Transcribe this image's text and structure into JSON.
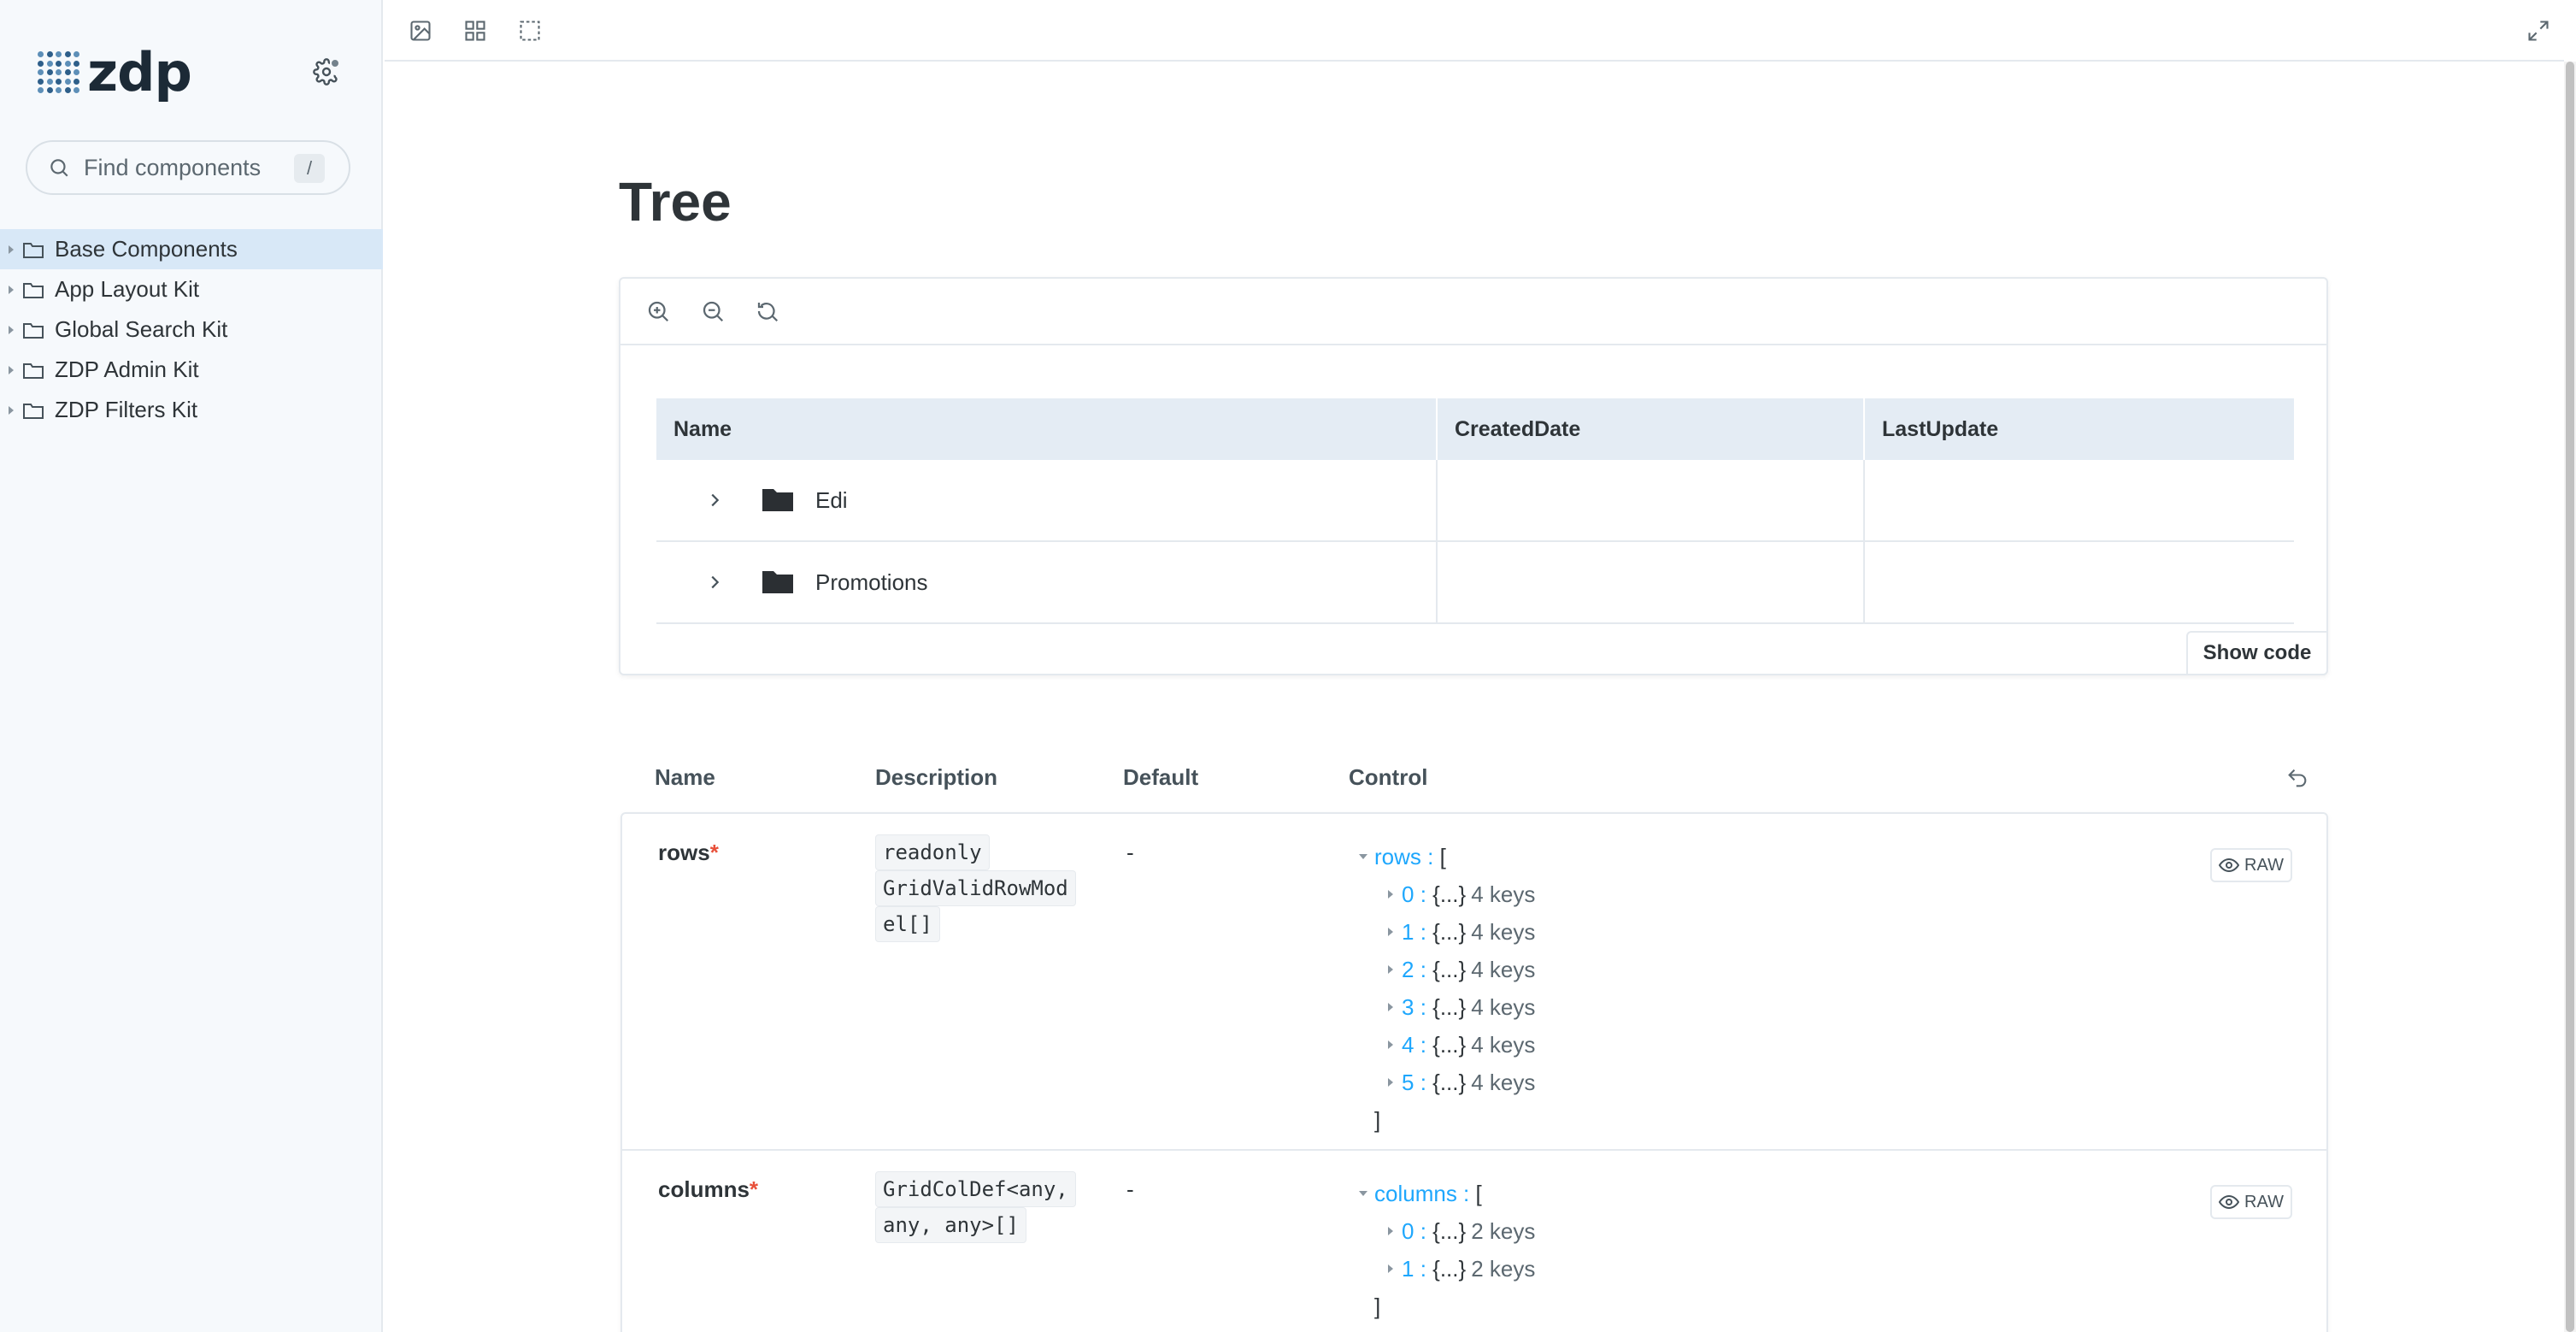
{
  "sidebar": {
    "brand": "zdp",
    "search_placeholder": "Find components",
    "search_shortcut": "/",
    "items": [
      {
        "label": "Base Components"
      },
      {
        "label": "App Layout Kit"
      },
      {
        "label": "Global Search Kit"
      },
      {
        "label": "ZDP Admin Kit"
      },
      {
        "label": "ZDP Filters Kit"
      }
    ]
  },
  "main": {
    "title": "Tree",
    "grid": {
      "headers": [
        "Name",
        "CreatedDate",
        "LastUpdate"
      ],
      "rows": [
        {
          "name": "Edi",
          "created": "",
          "updated": ""
        },
        {
          "name": "Promotions",
          "created": "",
          "updated": ""
        }
      ]
    },
    "show_code_label": "Show code"
  },
  "args": {
    "headers": [
      "Name",
      "Description",
      "Default",
      "Control"
    ],
    "rows": [
      {
        "name": "rows",
        "required_mark": "*",
        "type_lines": [
          "readonly",
          "GridValidRowMod",
          "el[]"
        ],
        "default": "-",
        "control_key": "rows",
        "open_bracket": "[",
        "close_bracket": "]",
        "entries": [
          {
            "index": "0",
            "summary": "{...}",
            "count": "4 keys"
          },
          {
            "index": "1",
            "summary": "{...}",
            "count": "4 keys"
          },
          {
            "index": "2",
            "summary": "{...}",
            "count": "4 keys"
          },
          {
            "index": "3",
            "summary": "{...}",
            "count": "4 keys"
          },
          {
            "index": "4",
            "summary": "{...}",
            "count": "4 keys"
          },
          {
            "index": "5",
            "summary": "{...}",
            "count": "4 keys"
          }
        ],
        "raw_label": "RAW"
      },
      {
        "name": "columns",
        "required_mark": "*",
        "type_lines": [
          "GridColDef<any,",
          "any, any>[]"
        ],
        "default": "-",
        "control_key": "columns",
        "open_bracket": "[",
        "close_bracket": "]",
        "entries": [
          {
            "index": "0",
            "summary": "{...}",
            "count": "2 keys"
          },
          {
            "index": "1",
            "summary": "{...}",
            "count": "2 keys"
          }
        ],
        "raw_label": "RAW"
      }
    ]
  },
  "icons": {
    "toolbar": [
      "image-icon",
      "grid-icon",
      "outline-icon",
      "fullscreen-icon"
    ],
    "preview_toolbar": [
      "zoom-in-icon",
      "zoom-out-icon",
      "reset-zoom-icon"
    ]
  },
  "colors": {
    "accent": "#1ea7fd",
    "required": "#e8503a",
    "active_item": "#d8e8f7",
    "grid_header": "#e4ecf4"
  }
}
